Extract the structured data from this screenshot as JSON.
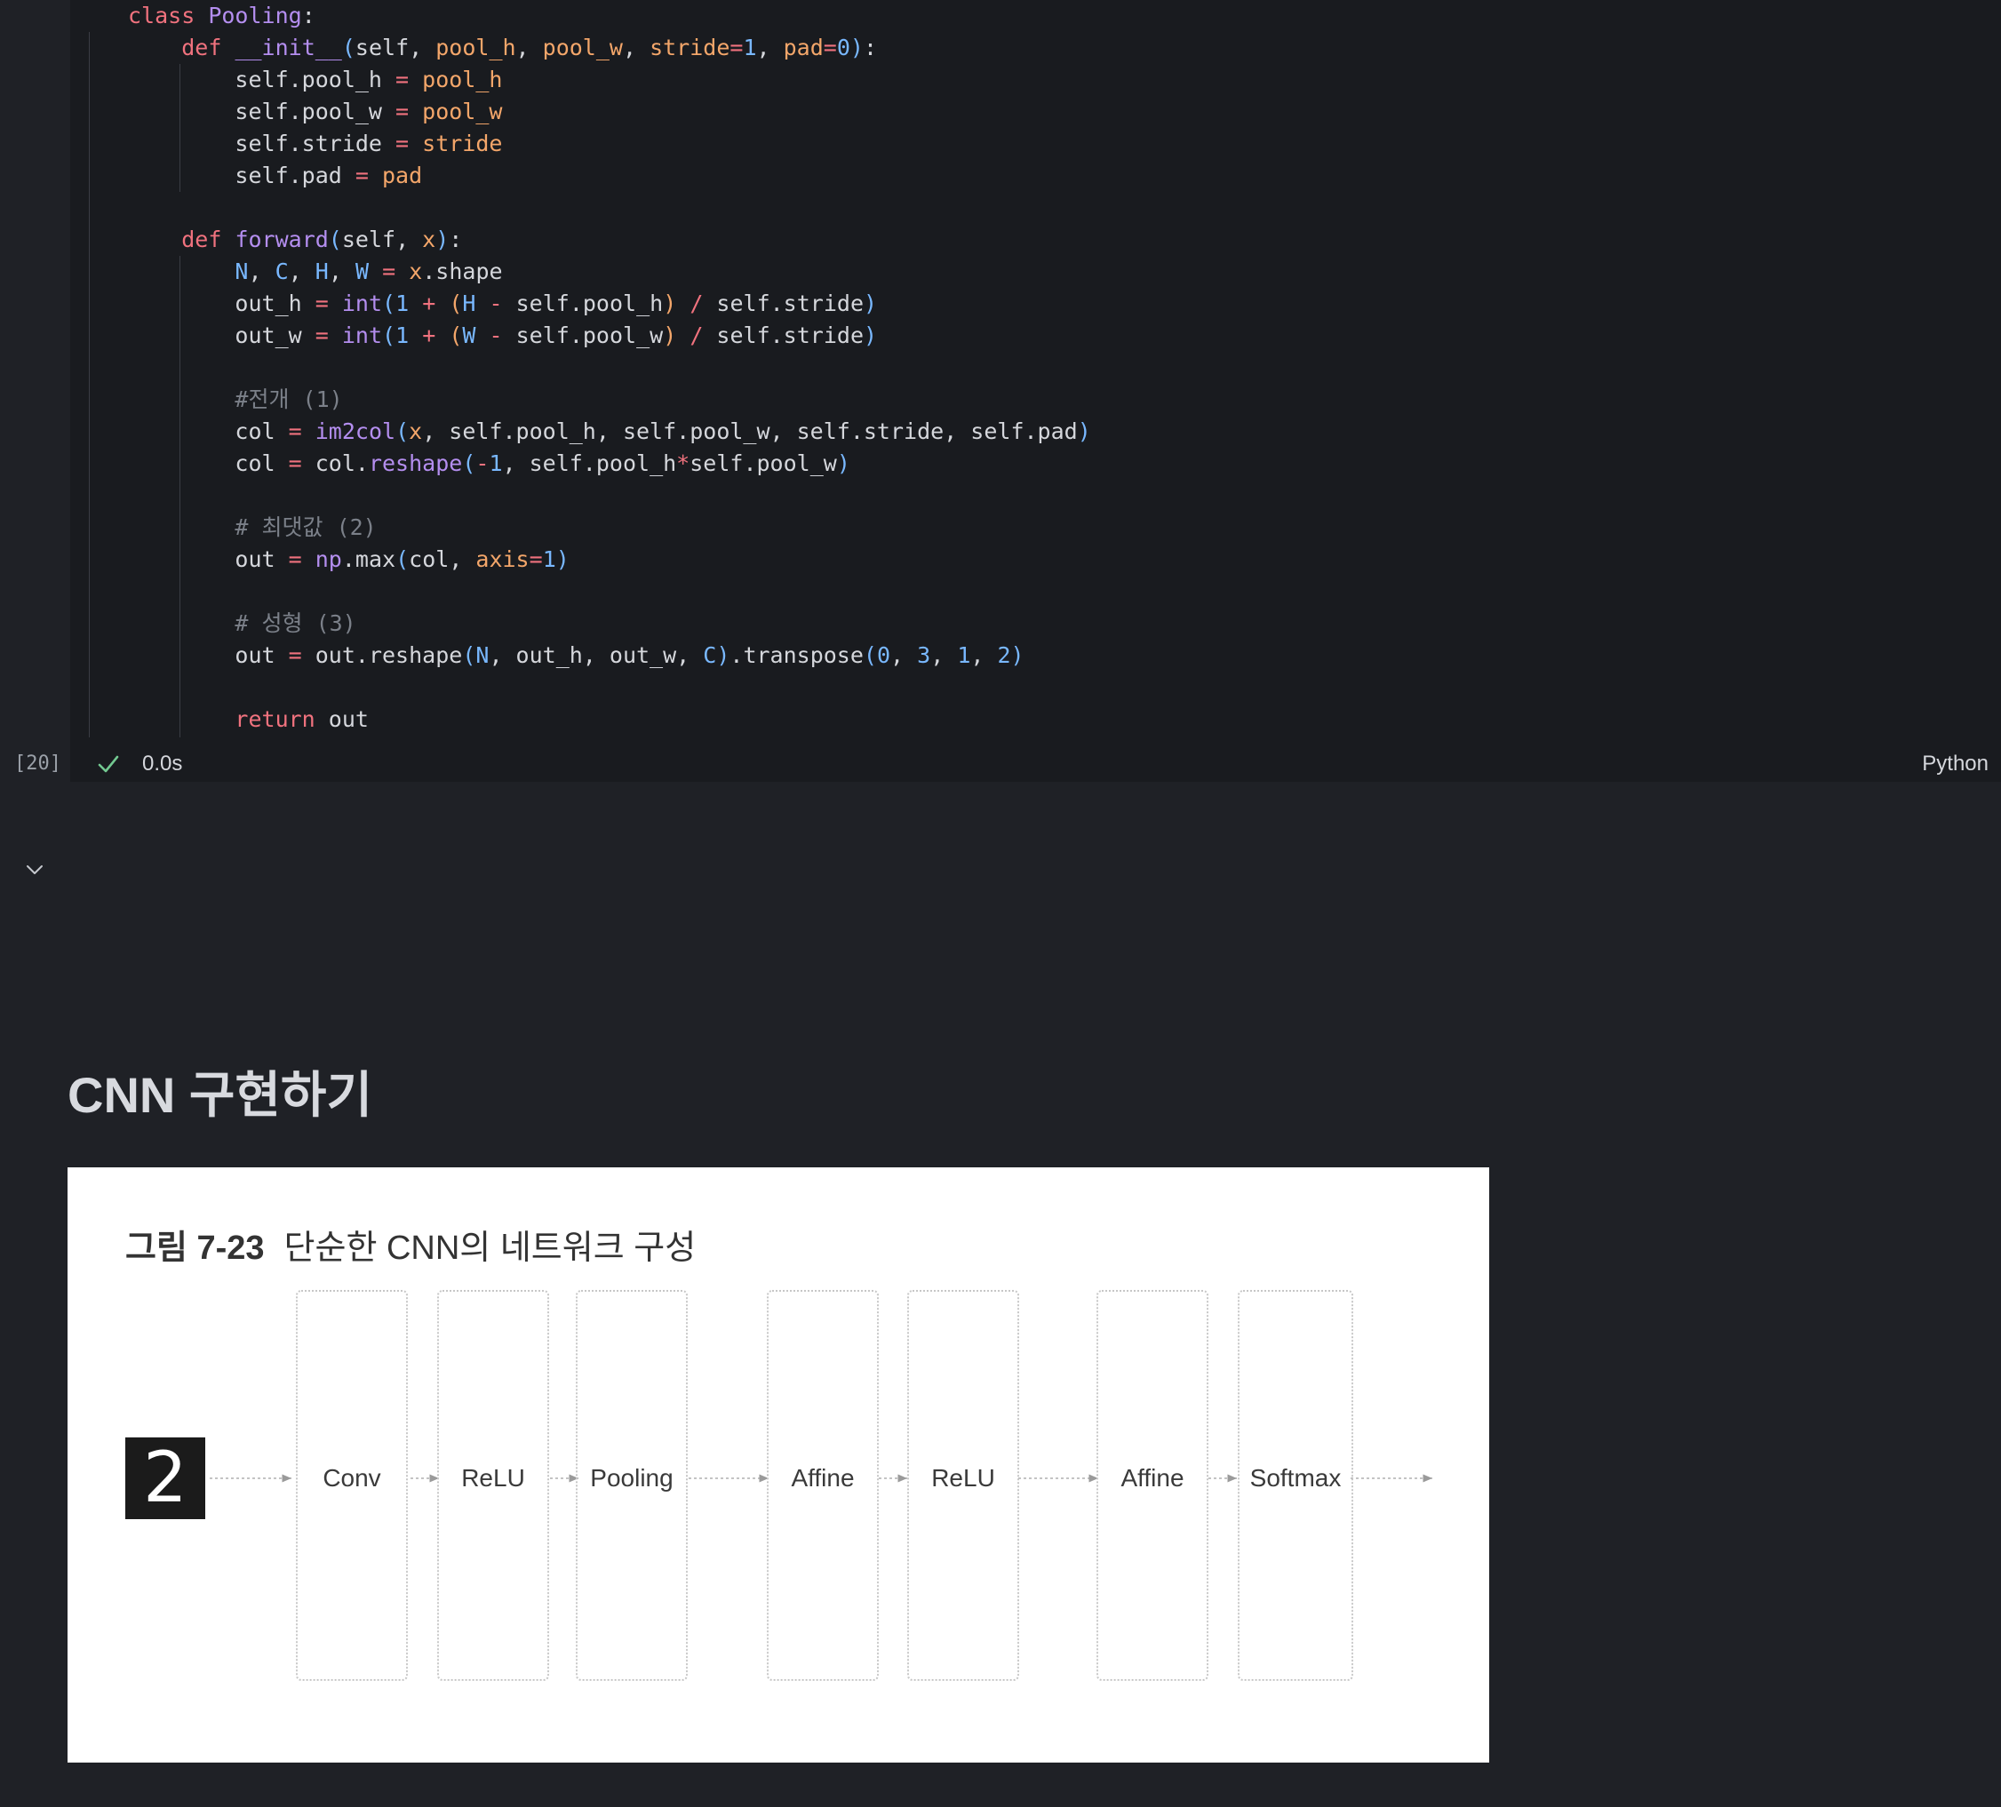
{
  "code_cell": {
    "execution_count": "[20]",
    "exec_time": "0.0s",
    "language": "Python",
    "status": "success"
  },
  "markdown_cell": {
    "heading": "CNN 구현하기",
    "figure": {
      "caption_number": "그림 7-23",
      "caption_text": "단순한 CNN의 네트워크 구성",
      "input_digit": "2",
      "layers": [
        "Conv",
        "ReLU",
        "Pooling",
        "Affine",
        "ReLU",
        "Affine",
        "Softmax"
      ]
    }
  },
  "colors": {
    "editor_bg": "#191b1f",
    "page_bg": "#1f2126",
    "keyword": "#f0727e",
    "function": "#b48eef",
    "parameter": "#f3a66a",
    "number": "#79b8ff",
    "comment": "#7b8089",
    "success_check": "#73c991"
  },
  "icons": {
    "status": "check-icon",
    "collapse": "chevron-down-icon"
  }
}
